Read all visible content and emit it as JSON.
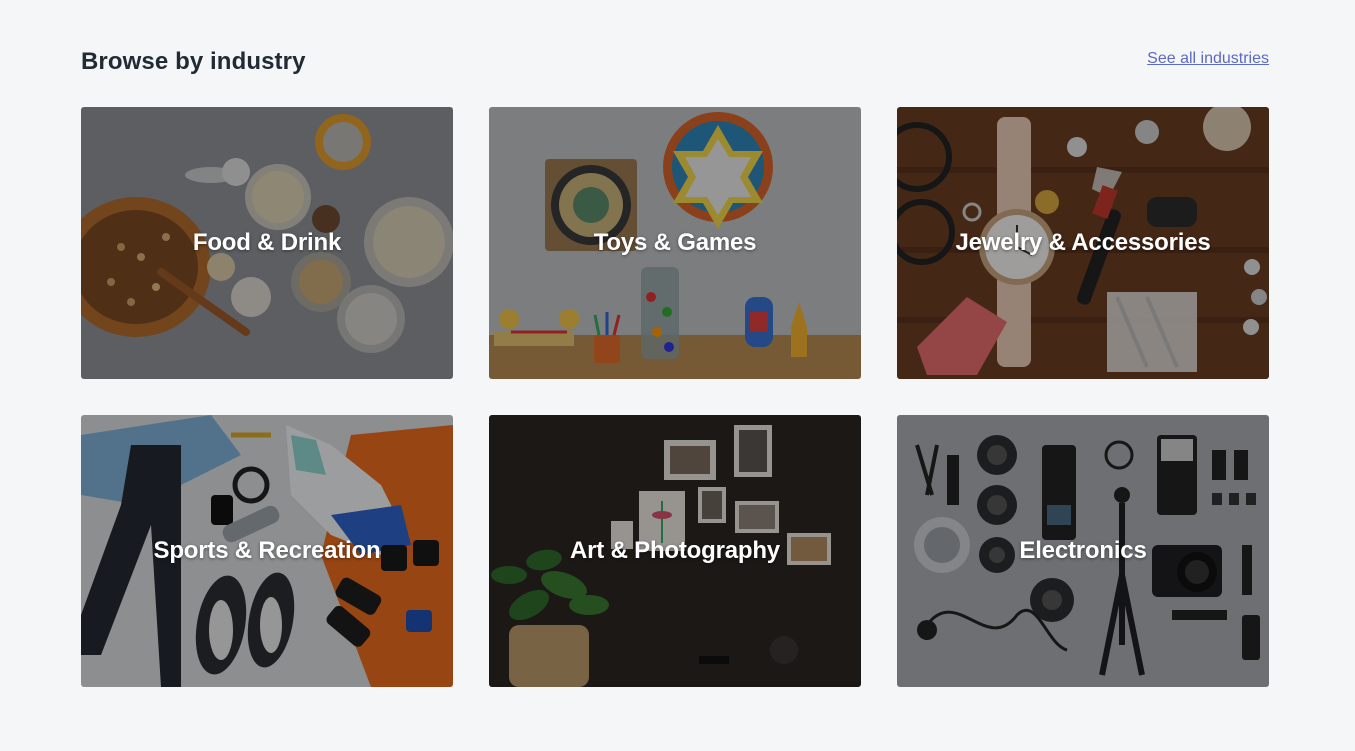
{
  "section": {
    "title": "Browse by industry",
    "see_all_label": "See all industries"
  },
  "industries": [
    {
      "label": "Food & Drink"
    },
    {
      "label": "Toys & Games"
    },
    {
      "label": "Jewelry & Accessories"
    },
    {
      "label": "Sports & Recreation"
    },
    {
      "label": "Art & Photography"
    },
    {
      "label": "Electronics"
    }
  ],
  "colors": {
    "background": "#f4f6f8",
    "heading": "#212b36",
    "link": "#5c6ac4",
    "card_label": "#ffffff"
  }
}
